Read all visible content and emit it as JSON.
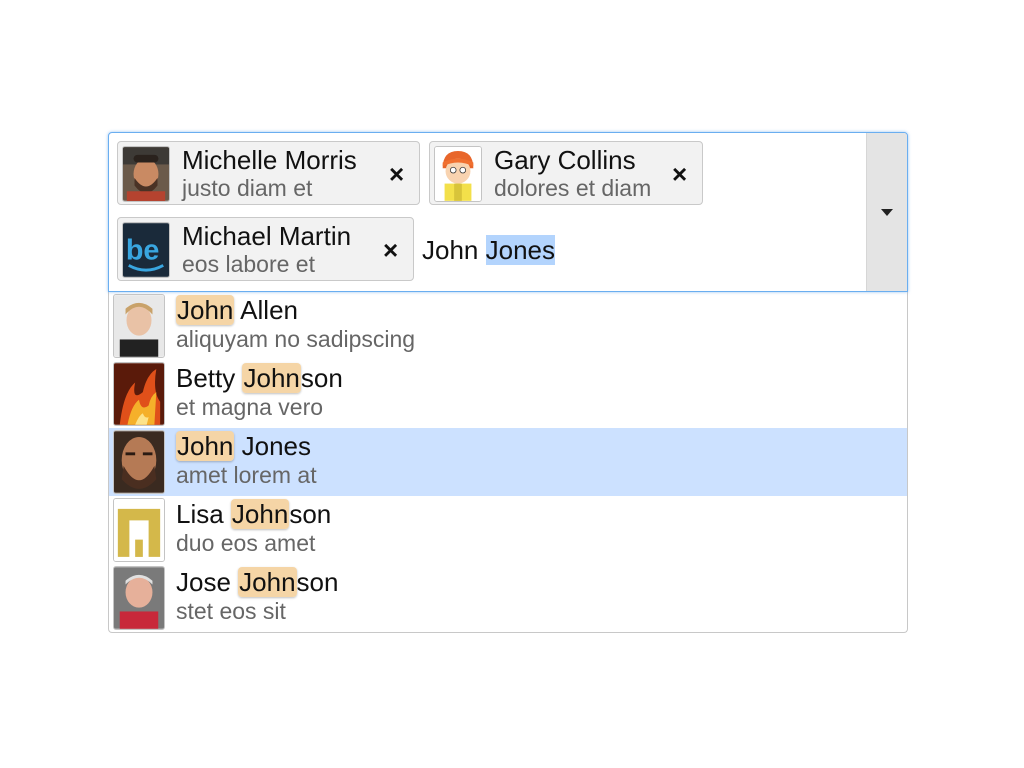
{
  "selected": [
    {
      "name": "Michelle Morris",
      "subtitle": "justo diam et",
      "remove": "×",
      "avatar": "bearded-man-photo"
    },
    {
      "name": "Gary Collins",
      "subtitle": "dolores et diam",
      "remove": "×",
      "avatar": "cartoon-boy-avatar"
    },
    {
      "name": "Michael Martin",
      "subtitle": "eos labore et",
      "remove": "×",
      "avatar": "be-logo-avatar"
    }
  ],
  "search": {
    "typed": "John ",
    "selected_text": "Jones"
  },
  "toggle_icon": "caret-down-icon",
  "options": [
    {
      "before": "",
      "match": "John",
      "after": " Allen",
      "subtitle": "aliquyam no sadipscing",
      "active": false,
      "avatar": "man-photo"
    },
    {
      "before": "Betty ",
      "match": "John",
      "after": "son",
      "subtitle": "et magna vero",
      "active": false,
      "avatar": "fire-art-avatar"
    },
    {
      "before": "",
      "match": "John",
      "after": " Jones",
      "subtitle": "amet lorem at",
      "active": true,
      "avatar": "bearded-face-photo"
    },
    {
      "before": "Lisa ",
      "match": "John",
      "after": "son",
      "subtitle": "duo eos amet",
      "active": false,
      "avatar": "yellow-arch-logo"
    },
    {
      "before": "Jose ",
      "match": "John",
      "after": "son",
      "subtitle": "stet eos sit",
      "active": false,
      "avatar": "older-man-photo"
    }
  ],
  "colors": {
    "focus_border": "#6aaef0",
    "active_row": "#cce1ff",
    "match_highlight": "#f5d5a6",
    "text_selection": "#b3d4fd"
  }
}
